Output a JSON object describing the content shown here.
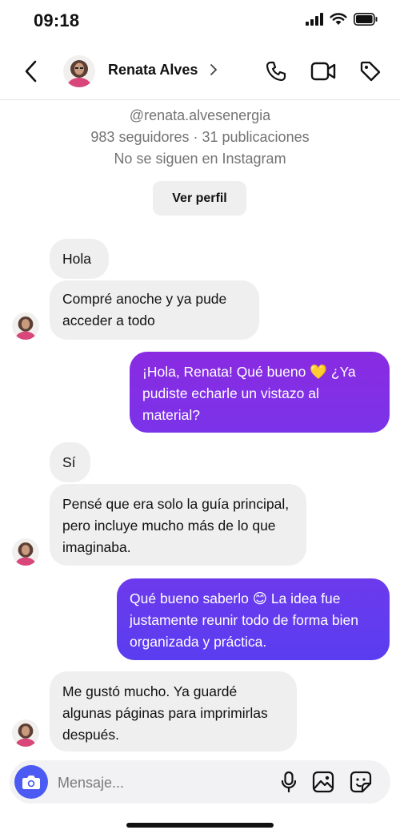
{
  "status_bar": {
    "time": "09:18"
  },
  "header": {
    "contact_name": "Renata Alves"
  },
  "profile": {
    "username": "@renata.alvesenergia",
    "stats": "983 seguidores · 31 publicaciones",
    "relationship": "No se siguen en Instagram",
    "view_profile_label": "Ver perfil"
  },
  "messages": [
    {
      "from": "them",
      "text": "Hola"
    },
    {
      "from": "them",
      "text": "Compré anoche y ya pude acceder a todo"
    },
    {
      "from": "me",
      "text": "¡Hola, Renata! Qué bueno 💛 ¿Ya pudiste echarle un vistazo al material?"
    },
    {
      "from": "them",
      "text": "Sí"
    },
    {
      "from": "them",
      "text": "Pensé que era solo la guía principal, pero incluye mucho más de lo que imaginaba."
    },
    {
      "from": "me",
      "text": "Qué bueno saberlo 😊 La idea fue justamente reunir todo de forma bien organizada y práctica."
    },
    {
      "from": "them",
      "text": "Me gustó mucho. Ya guardé algunas páginas para imprimirlas después."
    }
  ],
  "composer": {
    "placeholder": "Mensaje..."
  },
  "colors": {
    "sent_gradient_top": "#8a2be2",
    "sent_gradient_bottom": "#5a3df0",
    "received_bubble": "#efefef",
    "camera_button": "#4a5af2"
  }
}
